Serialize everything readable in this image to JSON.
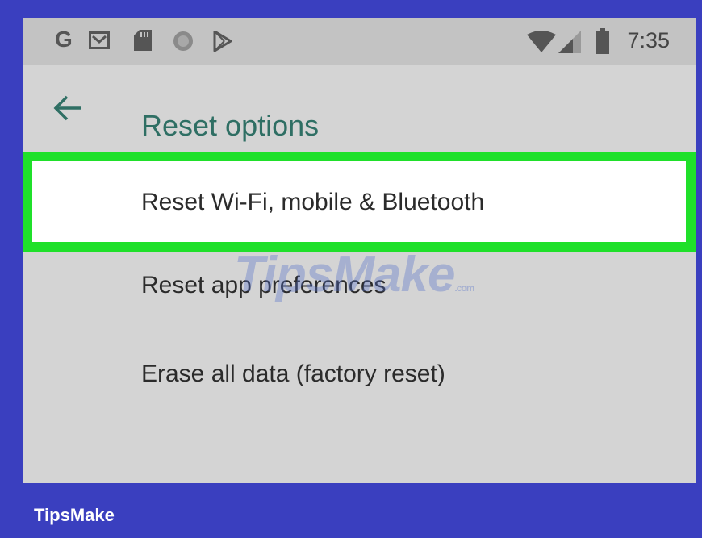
{
  "status_bar": {
    "google_letter": "G",
    "time": "7:35",
    "icons": [
      "google-icon",
      "gmail-icon",
      "sd-card-icon",
      "circle-icon",
      "play-store-icon",
      "wifi-icon",
      "signal-icon",
      "battery-icon"
    ]
  },
  "header": {
    "title": "Reset options",
    "back_icon": "arrow-left-icon"
  },
  "options": [
    {
      "label": "Reset Wi-Fi, mobile & Bluetooth",
      "highlighted": true
    },
    {
      "label": "Reset app preferences",
      "highlighted": false
    },
    {
      "label": "Erase all data (factory reset)",
      "highlighted": false
    }
  ],
  "watermark": {
    "text": "TipsMake",
    "suffix": ".com"
  },
  "brand": {
    "text": "TipsMake"
  },
  "colors": {
    "frame": "#3a3fbf",
    "screen_bg": "#d4d4d4",
    "status_bar_bg": "#c3c3c3",
    "title_teal": "#2f6f64",
    "highlight_green": "#1fe02a"
  }
}
